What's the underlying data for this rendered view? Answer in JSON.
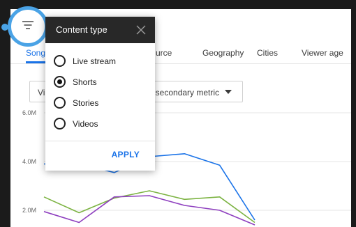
{
  "tabs": [
    {
      "label": "Song",
      "active": true
    },
    {
      "label": "urce",
      "active": false
    },
    {
      "label": "Geography",
      "active": false
    },
    {
      "label": "Cities",
      "active": false
    },
    {
      "label": "Viewer age",
      "active": false
    }
  ],
  "dropdowns": {
    "primary_label": "Vie",
    "secondary_label": "t secondary metric"
  },
  "filter": {
    "icon": "filter-icon",
    "accent_color": "#4aa3e6"
  },
  "popup": {
    "title": "Content type",
    "close_icon": "close-icon",
    "options": [
      {
        "label": "Live stream",
        "selected": false
      },
      {
        "label": "Shorts",
        "selected": true
      },
      {
        "label": "Stories",
        "selected": false
      },
      {
        "label": "Videos",
        "selected": false
      }
    ],
    "apply_label": "APPLY"
  },
  "chart_data": {
    "type": "line",
    "x": [
      1,
      2,
      3,
      4,
      5,
      6,
      7
    ],
    "y_ticks": [
      "6.0M",
      "4.0M",
      "2.0M"
    ],
    "y_tick_values": [
      6.0,
      4.0,
      2.0
    ],
    "ylim": [
      0,
      6.6
    ],
    "xlim": [
      1,
      7.3
    ],
    "grid": true,
    "series": [
      {
        "color": "#1a73e8",
        "values": [
          3.9,
          3.92,
          3.55,
          4.2,
          4.32,
          3.85,
          1.6
        ]
      },
      {
        "color": "#7cb342",
        "values": [
          2.55,
          1.9,
          2.5,
          2.8,
          2.45,
          2.55,
          1.5
        ]
      },
      {
        "color": "#8e3fbf",
        "values": [
          1.95,
          1.5,
          2.55,
          2.6,
          2.2,
          2.0,
          1.4
        ]
      }
    ]
  }
}
